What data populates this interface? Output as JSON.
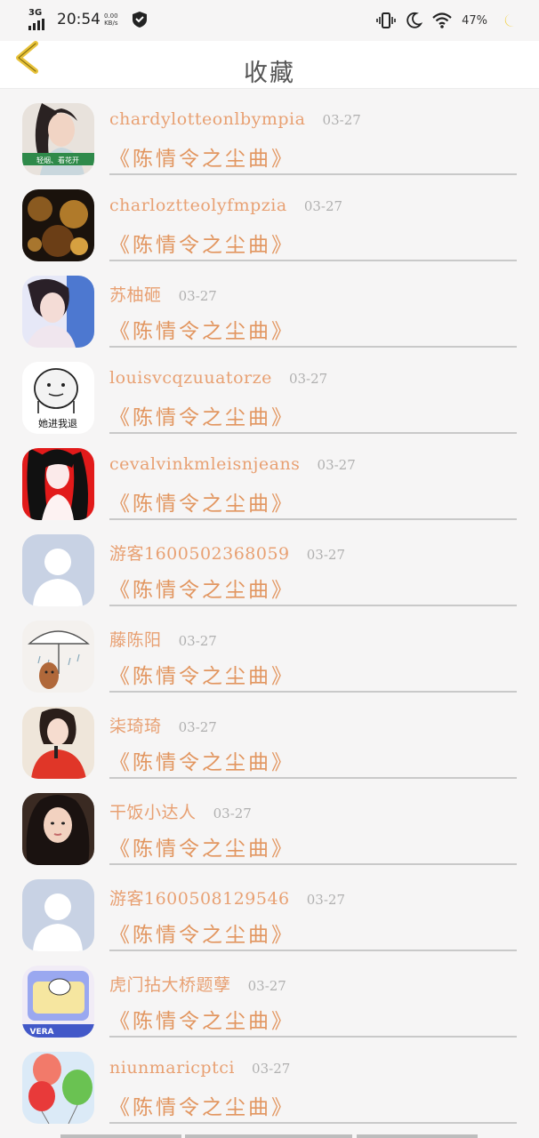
{
  "status_bar": {
    "network": "3G",
    "time": "20:54",
    "speed_value": "0.00",
    "speed_unit": "KB/s",
    "battery": "47%"
  },
  "header": {
    "title": "收藏"
  },
  "favorites": [
    {
      "user": "chardylotteonlbympia",
      "date": "03-27",
      "song": "《陈情令之尘曲》",
      "avatar_caption": "轻烟、看花开"
    },
    {
      "user": "charloztteolyfmpzia",
      "date": "03-27",
      "song": "《陈情令之尘曲》"
    },
    {
      "user": "苏柚砸",
      "date": "03-27",
      "song": "《陈情令之尘曲》"
    },
    {
      "user": "louisvcqzuuatorze",
      "date": "03-27",
      "song": "《陈情令之尘曲》",
      "avatar_caption": "她进我退"
    },
    {
      "user": "cevalvinkmleisnjeans",
      "date": "03-27",
      "song": "《陈情令之尘曲》"
    },
    {
      "user": "游客1600502368059",
      "date": "03-27",
      "song": "《陈情令之尘曲》"
    },
    {
      "user": "藤陈阳",
      "date": "03-27",
      "song": "《陈情令之尘曲》"
    },
    {
      "user": "柒琦琦",
      "date": "03-27",
      "song": "《陈情令之尘曲》"
    },
    {
      "user": "干饭小达人",
      "date": "03-27",
      "song": "《陈情令之尘曲》"
    },
    {
      "user": "游客1600508129546",
      "date": "03-27",
      "song": "《陈情令之尘曲》"
    },
    {
      "user": "虎门拈大桥题孽",
      "date": "03-27",
      "song": "《陈情令之尘曲》",
      "avatar_caption": "VERA"
    },
    {
      "user": "niunmaricptci",
      "date": "03-27",
      "song": "《陈情令之尘曲》"
    }
  ],
  "colors": {
    "username": "#e8a072",
    "song": "#e29660",
    "date": "#b0b0b0",
    "divider": "#c9c9c9",
    "back_arrow": "#e8c23a"
  }
}
